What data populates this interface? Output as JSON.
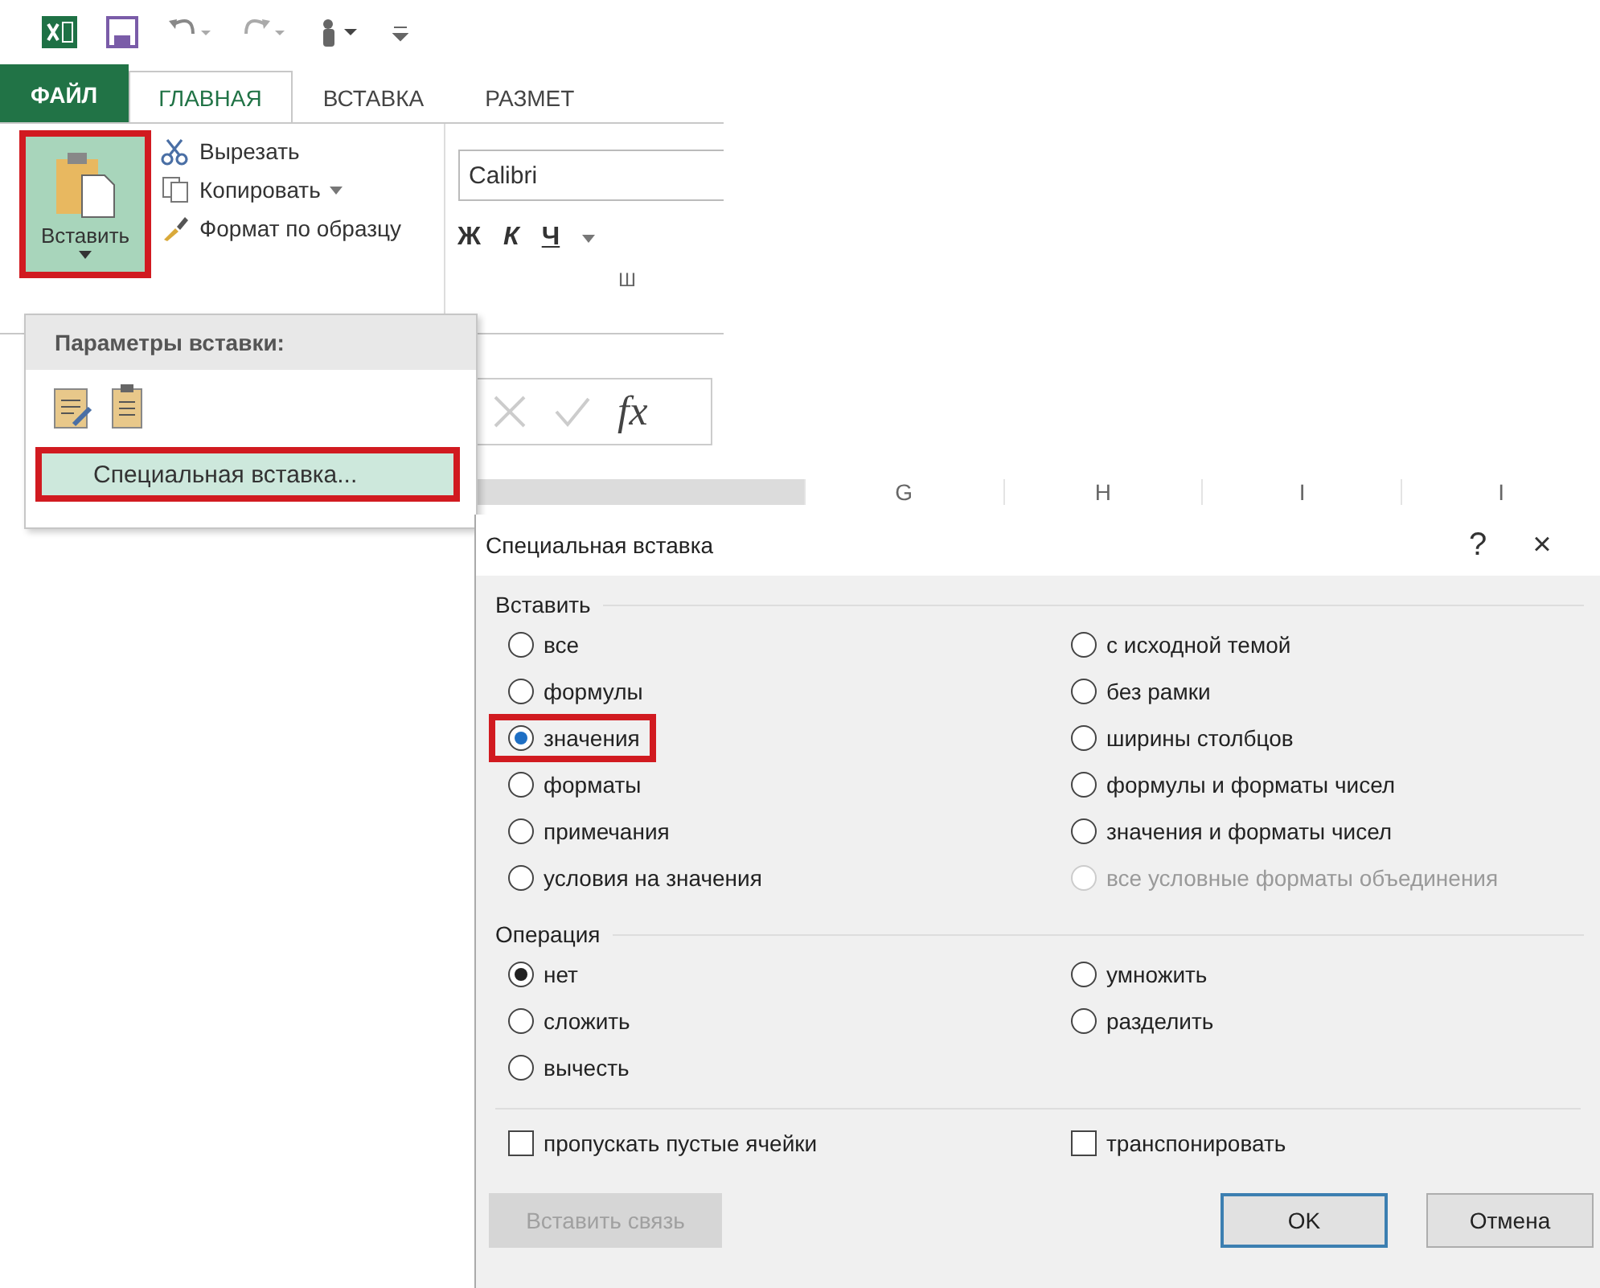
{
  "ribbon_tabs": [
    {
      "label": "ФАЙЛ",
      "kind": "file",
      "selected": false
    },
    {
      "label": "ГЛАВНАЯ",
      "kind": "tab",
      "selected": true
    },
    {
      "label": "ВСТАВКА",
      "kind": "tab",
      "selected": false
    },
    {
      "label": "РАЗМЕТ",
      "kind": "tab",
      "selected": false
    }
  ],
  "clipboard": {
    "paste_button": {
      "label": "Вставить",
      "highlighted": true
    },
    "actions": [
      "Вырезать",
      "Копировать",
      "Формат по образцу"
    ]
  },
  "font_group": {
    "font_name": "Calibri",
    "format_buttons": [
      "Ж",
      "К",
      "Ч"
    ],
    "group_label": "Ш"
  },
  "paste_menu": {
    "header": "Параметры вставки:",
    "item": {
      "label": "Специальная вставка...",
      "highlighted": true
    }
  },
  "formula_bar": {
    "function_label": "fx"
  },
  "column_headers": [
    "G",
    "H",
    "I",
    "I"
  ],
  "dialog": {
    "title": "Специальная вставка",
    "help": "?",
    "close": "×",
    "paste_section": "Вставить",
    "paste_options": [
      {
        "label": "все",
        "selected": false,
        "disabled": false,
        "highlighted": false
      },
      {
        "label": "формулы",
        "selected": false,
        "disabled": false,
        "highlighted": false
      },
      {
        "label": "значения",
        "selected": true,
        "disabled": false,
        "highlighted": true
      },
      {
        "label": "форматы",
        "selected": false,
        "disabled": false,
        "highlighted": false
      },
      {
        "label": "примечания",
        "selected": false,
        "disabled": false,
        "highlighted": false
      },
      {
        "label": "условия на значения",
        "selected": false,
        "disabled": false,
        "highlighted": false
      },
      {
        "label": "с исходной темой",
        "selected": false,
        "disabled": false,
        "highlighted": false
      },
      {
        "label": "без рамки",
        "selected": false,
        "disabled": false,
        "highlighted": false
      },
      {
        "label": "ширины столбцов",
        "selected": false,
        "disabled": false,
        "highlighted": false
      },
      {
        "label": "формулы и форматы чисел",
        "selected": false,
        "disabled": false,
        "highlighted": false
      },
      {
        "label": "значения и форматы чисел",
        "selected": false,
        "disabled": false,
        "highlighted": false
      },
      {
        "label": "все условные форматы объединения",
        "selected": false,
        "disabled": true,
        "highlighted": false
      }
    ],
    "operation_section": "Операция",
    "operations": [
      {
        "label": "нет",
        "selected": true
      },
      {
        "label": "сложить",
        "selected": false
      },
      {
        "label": "вычесть",
        "selected": false
      },
      {
        "label": "умножить",
        "selected": false
      },
      {
        "label": "разделить",
        "selected": false
      }
    ],
    "checkboxes": [
      {
        "label": "пропускать пустые ячейки",
        "checked": false
      },
      {
        "label": "транспонировать",
        "checked": false
      }
    ],
    "buttons": [
      {
        "label": "Вставить связь",
        "kind": "link",
        "disabled": true
      },
      {
        "label": "OK",
        "kind": "default",
        "disabled": false
      },
      {
        "label": "Отмена",
        "kind": "cancel",
        "disabled": false
      }
    ]
  }
}
